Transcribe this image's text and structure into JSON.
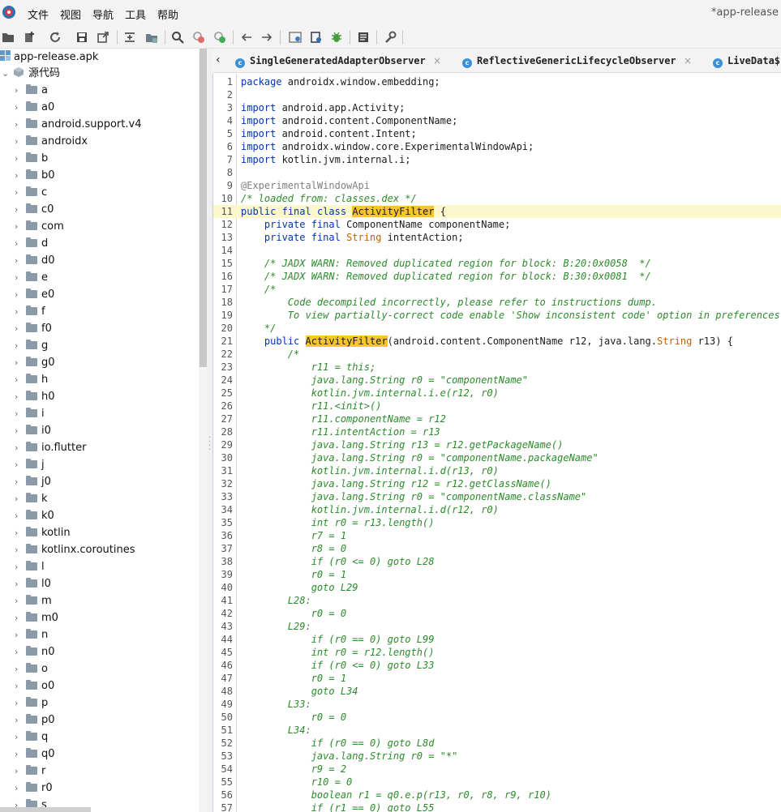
{
  "window": {
    "title": "*app-release",
    "menu": [
      "文件",
      "视图",
      "导航",
      "工具",
      "帮助"
    ]
  },
  "toolbar": {
    "icons": [
      "open-folder-icon",
      "add-files-icon",
      "refresh-icon",
      "save-icon",
      "export-icon",
      "sync-icon",
      "toggle-tree-icon",
      "search-icon",
      "find-class-icon",
      "find-usage-icon",
      "back-icon",
      "forward-icon",
      "quick-tab-icon",
      "deobfuscation-icon",
      "debugger-icon",
      "log-icon",
      "preferences-icon"
    ]
  },
  "tree": {
    "root": "app-release.apk",
    "source_node": "源代码",
    "packages": [
      "a",
      "a0",
      "android.support.v4",
      "androidx",
      "b",
      "b0",
      "c",
      "c0",
      "com",
      "d",
      "d0",
      "e",
      "e0",
      "f",
      "f0",
      "g",
      "g0",
      "h",
      "h0",
      "i",
      "i0",
      "io.flutter",
      "j",
      "j0",
      "k",
      "k0",
      "kotlin",
      "kotlinx.coroutines",
      "l",
      "l0",
      "m",
      "m0",
      "n",
      "n0",
      "o",
      "o0",
      "p",
      "p0",
      "q",
      "q0",
      "r",
      "r0",
      "s"
    ]
  },
  "tabs": [
    {
      "label": "SingleGeneratedAdapterObserver",
      "icon": "class-icon",
      "close": "×"
    },
    {
      "label": "ReflectiveGenericLifecycleObserver",
      "icon": "class-icon",
      "close": "×"
    },
    {
      "label": "LiveData$L",
      "icon": "class-icon"
    }
  ],
  "tab_back": "‹",
  "code": {
    "highlight_word": "ActivityFilter",
    "lines": [
      {
        "n": "1",
        "t": "package androidx.window.embedding;"
      },
      {
        "n": "2",
        "t": ""
      },
      {
        "n": "3",
        "t": "import android.app.Activity;"
      },
      {
        "n": "4",
        "t": "import android.content.ComponentName;"
      },
      {
        "n": "5",
        "t": "import android.content.Intent;"
      },
      {
        "n": "6",
        "t": "import androidx.window.core.ExperimentalWindowApi;"
      },
      {
        "n": "7",
        "t": "import kotlin.jvm.internal.i;"
      },
      {
        "n": "8",
        "t": ""
      },
      {
        "n": "9",
        "t": "@ExperimentalWindowApi"
      },
      {
        "n": "10",
        "t": "/* loaded from: classes.dex */"
      },
      {
        "n": "11",
        "t": "public final class ActivityFilter {"
      },
      {
        "n": "12",
        "t": "    private final ComponentName componentName;"
      },
      {
        "n": "13",
        "t": "    private final String intentAction;"
      },
      {
        "n": "14",
        "t": ""
      },
      {
        "n": "15",
        "t": "    /* JADX WARN: Removed duplicated region for block: B:20:0x0058  */"
      },
      {
        "n": "16",
        "t": "    /* JADX WARN: Removed duplicated region for block: B:30:0x0081  */"
      },
      {
        "n": "17",
        "t": "    /*"
      },
      {
        "n": "18",
        "t": "        Code decompiled incorrectly, please refer to instructions dump."
      },
      {
        "n": "19",
        "t": "        To view partially-correct code enable 'Show inconsistent code' option in preferences"
      },
      {
        "n": "20",
        "t": "    */"
      },
      {
        "n": "21",
        "t": "    public ActivityFilter(android.content.ComponentName r12, java.lang.String r13) {"
      },
      {
        "n": "22",
        "t": "        /*"
      },
      {
        "n": "23",
        "t": "            r11 = this;"
      },
      {
        "n": "24",
        "t": "            java.lang.String r0 = \"componentName\""
      },
      {
        "n": "25",
        "t": "            kotlin.jvm.internal.i.e(r12, r0)"
      },
      {
        "n": "26",
        "t": "            r11.<init>()"
      },
      {
        "n": "27",
        "t": "            r11.componentName = r12"
      },
      {
        "n": "28",
        "t": "            r11.intentAction = r13"
      },
      {
        "n": "29",
        "t": "            java.lang.String r13 = r12.getPackageName()"
      },
      {
        "n": "30",
        "t": "            java.lang.String r0 = \"componentName.packageName\""
      },
      {
        "n": "31",
        "t": "            kotlin.jvm.internal.i.d(r13, r0)"
      },
      {
        "n": "32",
        "t": "            java.lang.String r12 = r12.getClassName()"
      },
      {
        "n": "33",
        "t": "            java.lang.String r0 = \"componentName.className\""
      },
      {
        "n": "34",
        "t": "            kotlin.jvm.internal.i.d(r12, r0)"
      },
      {
        "n": "35",
        "t": "            int r0 = r13.length()"
      },
      {
        "n": "36",
        "t": "            r7 = 1"
      },
      {
        "n": "37",
        "t": "            r8 = 0"
      },
      {
        "n": "38",
        "t": "            if (r0 <= 0) goto L28"
      },
      {
        "n": "39",
        "t": "            r0 = 1"
      },
      {
        "n": "40",
        "t": "            goto L29"
      },
      {
        "n": "41",
        "t": "        L28:"
      },
      {
        "n": "42",
        "t": "            r0 = 0"
      },
      {
        "n": "43",
        "t": "        L29:"
      },
      {
        "n": "44",
        "t": "            if (r0 == 0) goto L99"
      },
      {
        "n": "45",
        "t": "            int r0 = r12.length()"
      },
      {
        "n": "46",
        "t": "            if (r0 <= 0) goto L33"
      },
      {
        "n": "47",
        "t": "            r0 = 1"
      },
      {
        "n": "48",
        "t": "            goto L34"
      },
      {
        "n": "49",
        "t": "        L33:"
      },
      {
        "n": "50",
        "t": "            r0 = 0"
      },
      {
        "n": "51",
        "t": "        L34:"
      },
      {
        "n": "52",
        "t": "            if (r0 == 0) goto L8d"
      },
      {
        "n": "53",
        "t": "            java.lang.String r0 = \"*\""
      },
      {
        "n": "54",
        "t": "            r9 = 2"
      },
      {
        "n": "55",
        "t": "            r10 = 0"
      },
      {
        "n": "56",
        "t": "            boolean r1 = q0.e.p(r13, r0, r8, r9, r10)"
      },
      {
        "n": "57",
        "t": "            if (r1 == 0) goto L55"
      }
    ]
  },
  "colors": {
    "keyword": "#0033b3",
    "comment": "#2d8a2d",
    "type": "#b8620b",
    "highlight": "#f7c62a",
    "current_line": "#fcf8cc"
  }
}
